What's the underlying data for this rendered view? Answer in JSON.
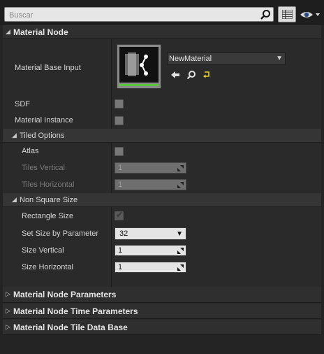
{
  "search": {
    "placeholder": "Buscar",
    "value": ""
  },
  "sections": {
    "material_node": {
      "title": "Material Node",
      "base_input": {
        "label": "Material Base Input",
        "asset_name": "NewMaterial"
      },
      "sdf": {
        "label": "SDF",
        "checked": false
      },
      "material_instance": {
        "label": "Material Instance",
        "checked": false
      },
      "tiled_options": {
        "title": "Tiled Options",
        "atlas": {
          "label": "Atlas",
          "checked": false
        },
        "tiles_vertical": {
          "label": "Tiles Vertical",
          "value": "1"
        },
        "tiles_horizontal": {
          "label": "Tiles Horizontal",
          "value": "1"
        }
      },
      "non_square_size": {
        "title": "Non Square Size",
        "rectangle_size": {
          "label": "Rectangle Size",
          "checked": true
        },
        "set_size_by_parameter": {
          "label": "Set Size by Parameter",
          "value": "32"
        },
        "size_vertical": {
          "label": "Size Vertical",
          "value": "1"
        },
        "size_horizontal": {
          "label": "Size Horizontal",
          "value": "1"
        }
      }
    },
    "parameters": {
      "title": "Material Node Parameters"
    },
    "time_parameters": {
      "title": "Material Node Time Parameters"
    },
    "tile_data_base": {
      "title": "Material Node Tile Data Base"
    }
  },
  "icons": {
    "search": "search-icon",
    "grid": "grid-view-icon",
    "eye": "eye-icon",
    "use_selected": "arrow-left-icon",
    "browse": "magnifier-icon",
    "reset": "reset-arrow-icon"
  },
  "colors": {
    "panel": "#2a2a2a",
    "field": "#e4e4e4",
    "accent_green": "#5ac43a",
    "reset_yellow": "#e8d230"
  }
}
